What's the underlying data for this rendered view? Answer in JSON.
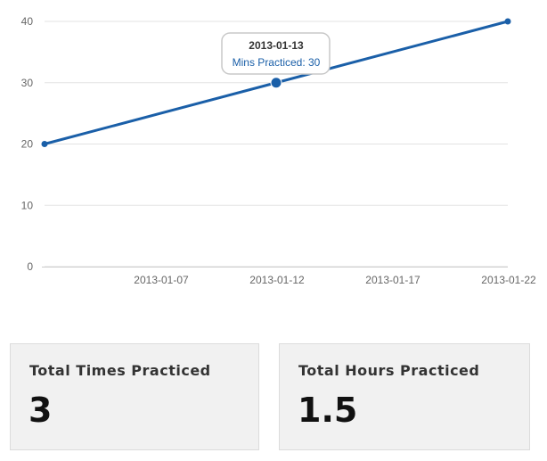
{
  "chart_data": {
    "type": "line",
    "x": [
      "2013-01-02",
      "2013-01-12",
      "2013-01-22"
    ],
    "series": [
      {
        "name": "Mins Practiced",
        "values": [
          20,
          30,
          40
        ],
        "color": "#1a5fa8"
      }
    ],
    "x_range": [
      "2013-01-02",
      "2013-01-22"
    ],
    "x_ticks": [
      "2013-01-07",
      "2013-01-12",
      "2013-01-17",
      "2013-01-22"
    ],
    "ylim": [
      0,
      40
    ],
    "y_ticks": [
      0,
      10,
      20,
      30,
      40
    ],
    "grid": true,
    "tooltip": {
      "date": "2013-01-13",
      "label": "Mins Practiced: 30"
    },
    "title": "",
    "xlabel": "",
    "ylabel": ""
  },
  "stats": {
    "times": {
      "title": "Total Times Practiced",
      "value": "3"
    },
    "hours": {
      "title": "Total Hours Practiced",
      "value": "1.5"
    }
  }
}
